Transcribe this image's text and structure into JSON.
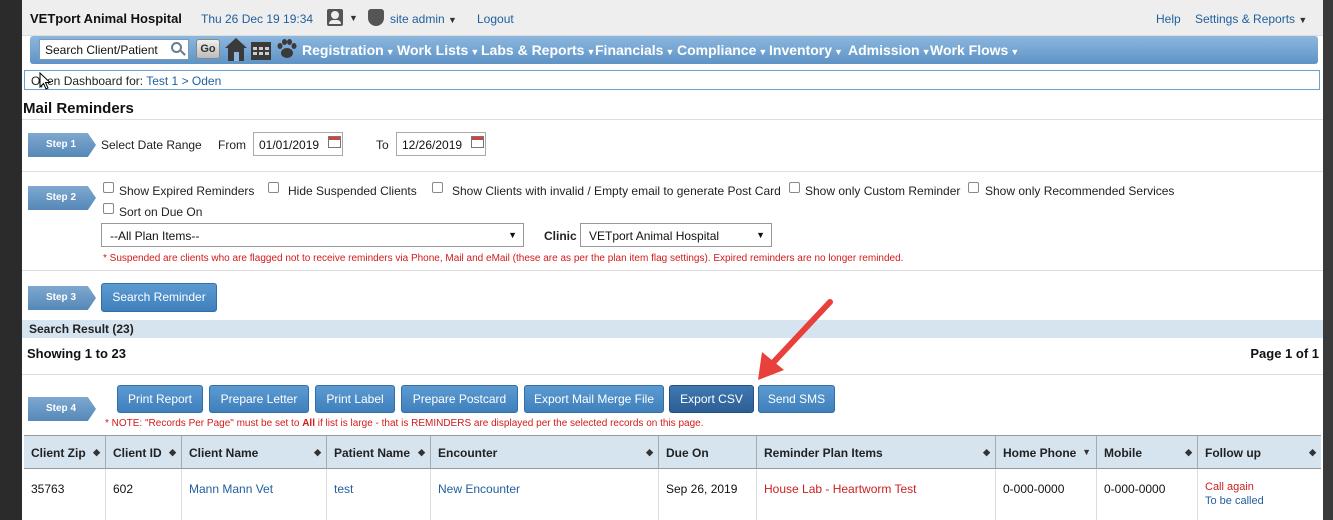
{
  "topbar": {
    "brand": "VETport Animal Hospital",
    "datetime": "Thu 26 Dec 19 19:34",
    "user": "site admin",
    "logout": "Logout",
    "help": "Help",
    "settings": "Settings & Reports"
  },
  "nav": {
    "search_placeholder": "Search Client/Patient",
    "go": "Go",
    "items": [
      "Registration",
      "Work Lists",
      "Labs & Reports",
      "Financials",
      "Compliance",
      "Inventory",
      "Admission",
      "Work Flows"
    ]
  },
  "dashboard": {
    "prefix": "Open Dashboard for:",
    "client": "Test 1",
    "sep": ">",
    "patient": "Oden"
  },
  "page_title": "Mail Reminders",
  "step1": {
    "label": "Step 1",
    "title": "Select Date Range",
    "from_label": "From",
    "from_value": "01/01/2019",
    "to_label": "To",
    "to_value": "12/26/2019"
  },
  "step2": {
    "label": "Step 2",
    "checkboxes": [
      "Show Expired Reminders",
      "Hide Suspended Clients",
      "Show Clients with invalid / Empty email to generate Post Card",
      "Show only Custom Reminder",
      "Show only Recommended Services",
      "Sort on Due On"
    ],
    "plan_select": "--All Plan Items--",
    "clinic_label": "Clinic",
    "clinic_select": "VETport Animal Hospital",
    "note": "* Suspended are clients who are flagged not to receive reminders via Phone, Mail and eMail (these are as per the plan item flag settings). Expired reminders are no longer reminded."
  },
  "step3": {
    "label": "Step 3",
    "button": "Search Reminder"
  },
  "results": {
    "header": "Search Result (23)",
    "showing": "Showing 1 to 23",
    "page": "Page 1 of 1"
  },
  "step4": {
    "label": "Step 4",
    "buttons": [
      "Print Report",
      "Prepare Letter",
      "Print Label",
      "Prepare Postcard",
      "Export Mail Merge File",
      "Export CSV",
      "Send SMS"
    ],
    "note_prefix": "* NOTE: \"Records Per Page\" must be set to ",
    "note_all": "All",
    "note_suffix": " if list is large - that is REMINDERS are displayed per the selected records on this page."
  },
  "table": {
    "headers": [
      "Client Zip",
      "Client ID",
      "Client Name",
      "Patient Name",
      "Encounter",
      "Due On",
      "Reminder Plan Items",
      "Home Phone",
      "Mobile",
      "Follow up"
    ],
    "row": {
      "zip": "35763",
      "id": "602",
      "client_name": "Mann Mann Vet",
      "patient": "test",
      "encounter": "New Encounter",
      "due_on": "Sep 26, 2019",
      "plan_item": "House Lab - Heartworm Test",
      "home_phone": "0-000-0000",
      "mobile": "0-000-0000",
      "followup_1": "Call again",
      "followup_2": "To be called"
    }
  },
  "colors": {
    "accent": "#4a8ac4",
    "nav": "#6f9fd0",
    "link": "#1f5f9e",
    "warning": "#d21a1a",
    "arrow": "#e8403a"
  },
  "icons": [
    "user-icon",
    "shield-icon",
    "search-icon",
    "home-icon",
    "calendar-icon",
    "paw-icon",
    "sort-icon",
    "red-arrow-annotation"
  ]
}
